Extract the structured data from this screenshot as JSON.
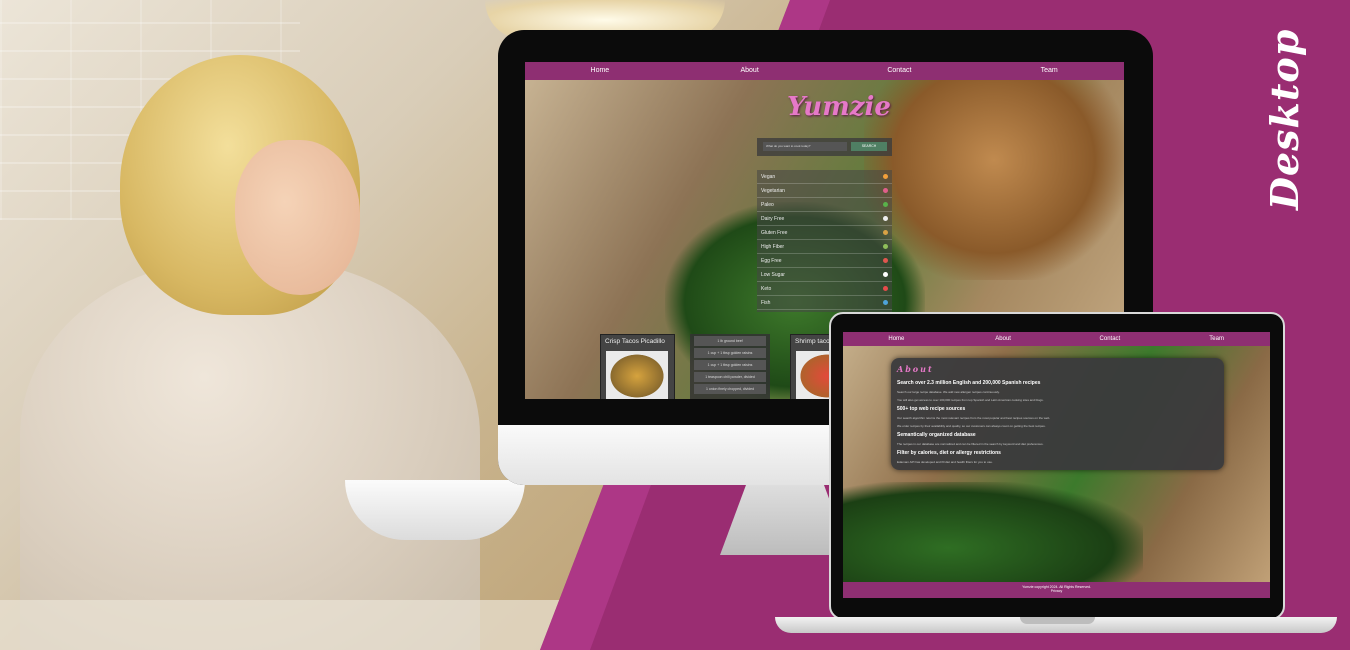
{
  "badge_label": "Desktop",
  "monitor_site": {
    "nav": [
      "Home",
      "About",
      "Contact",
      "Team"
    ],
    "logo": "Yumzie",
    "search_placeholder": "What do you want to cook today?",
    "search_button": "SEARCH",
    "diets": [
      {
        "label": "Vegan",
        "color": "#f2a03b"
      },
      {
        "label": "Vegetarian",
        "color": "#e05f8a"
      },
      {
        "label": "Paleo",
        "color": "#59b14a"
      },
      {
        "label": "Dairy Free",
        "color": "#eeeeee"
      },
      {
        "label": "Gluten Free",
        "color": "#d9a245"
      },
      {
        "label": "High Fiber",
        "color": "#8fbf5a"
      },
      {
        "label": "Egg Free",
        "color": "#e0564f"
      },
      {
        "label": "Low Sugar",
        "color": "#ffffff"
      },
      {
        "label": "Keto",
        "color": "#e84b4b"
      },
      {
        "label": "Fish",
        "color": "#4ea3d8"
      }
    ],
    "card1_title": "Crisp Tacos Picadillo",
    "card2_title": "Shrimp tacos with...",
    "ingredients": [
      "1 lb ground beef",
      "1 cup + 1 tbsp golden raisins",
      "1 cup + 1 tbsp golden raisins",
      "1 teaspoon chili powder, divided",
      "1 onion finely chopped, divided"
    ]
  },
  "laptop_site": {
    "nav": [
      "Home",
      "About",
      "Contact",
      "Team"
    ],
    "about_title": "About",
    "sections": [
      {
        "heading": "Search over 2.3 million English and 200,000 Spanish recipes",
        "text": [
          "Search our large recipe database. We add new allergen recipes continuously.",
          "You will also get access to over 100,000 recipes from top Spanish and Latin American cooking sites and blogs."
        ]
      },
      {
        "heading": "500+ top web recipe sources",
        "text": [
          "Our search algorithm returns the most relevant recipes from the most popular and best recipes sources on the web.",
          "We order recipes by their availability and quality, so our customers can always count on getting the best recipes."
        ]
      },
      {
        "heading": "Semantically organized database",
        "text": [
          "The recipes in our database are normalized and can be filtered in the search by keyword and diet preferences."
        ]
      },
      {
        "heading": "Filter by calories, diet or allergy restrictions",
        "text": [
          "Edamam API has developed and fill diet and health filters for you to use."
        ]
      }
    ],
    "footer": "Yumzie copyright 2024. All Rights Reserved.",
    "footer_sub": "Privacy"
  }
}
